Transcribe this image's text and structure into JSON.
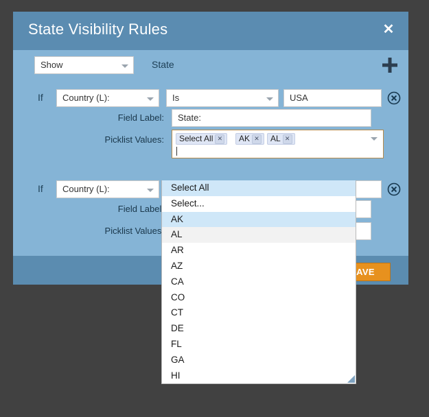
{
  "dialog": {
    "title": "State Visibility Rules",
    "close_icon": "close-icon"
  },
  "toolbar": {
    "action_value": "Show",
    "field_name": "State",
    "add_icon": "plus-icon"
  },
  "rules": [
    {
      "if_label": "If",
      "condition_field": "Country (L):",
      "condition_operator": "Is",
      "condition_value": "USA",
      "remove_icon": "circle-x-icon",
      "field_label_caption": "Field Label:",
      "field_label_value": "State:",
      "picklist_caption": "Picklist Values:",
      "picklist_chips": [
        "Select All",
        "AK",
        "AL"
      ],
      "chip_remove_icon": "x-icon"
    },
    {
      "if_label": "If",
      "condition_field": "Country (L):",
      "condition_operator": "",
      "condition_value": "",
      "remove_icon": "circle-x-icon",
      "field_label_caption": "Field Label:",
      "field_label_value": "",
      "picklist_caption": "Picklist Values:"
    }
  ],
  "picklist_dropdown": {
    "options": [
      {
        "label": "Select All",
        "state": "selected"
      },
      {
        "label": "Select...",
        "state": "normal"
      },
      {
        "label": "AK",
        "state": "selected"
      },
      {
        "label": "AL",
        "state": "hover"
      },
      {
        "label": "AR",
        "state": "normal"
      },
      {
        "label": "AZ",
        "state": "normal"
      },
      {
        "label": "CA",
        "state": "normal"
      },
      {
        "label": "CO",
        "state": "normal"
      },
      {
        "label": "CT",
        "state": "normal"
      },
      {
        "label": "DE",
        "state": "normal"
      },
      {
        "label": "FL",
        "state": "normal"
      },
      {
        "label": "GA",
        "state": "normal"
      },
      {
        "label": "HI",
        "state": "normal"
      }
    ],
    "resize_icon": "resize-grip-icon"
  },
  "footer": {
    "save_label": "SAVE"
  },
  "colors": {
    "page_background": "#414141",
    "dialog_header": "#5b8cb1",
    "dialog_body": "#85b4d6",
    "dialog_footer": "#5b8cb0",
    "save_button": "#e7911e",
    "option_selected": "#cfe7f8",
    "focus_border": "#b58a4b"
  }
}
